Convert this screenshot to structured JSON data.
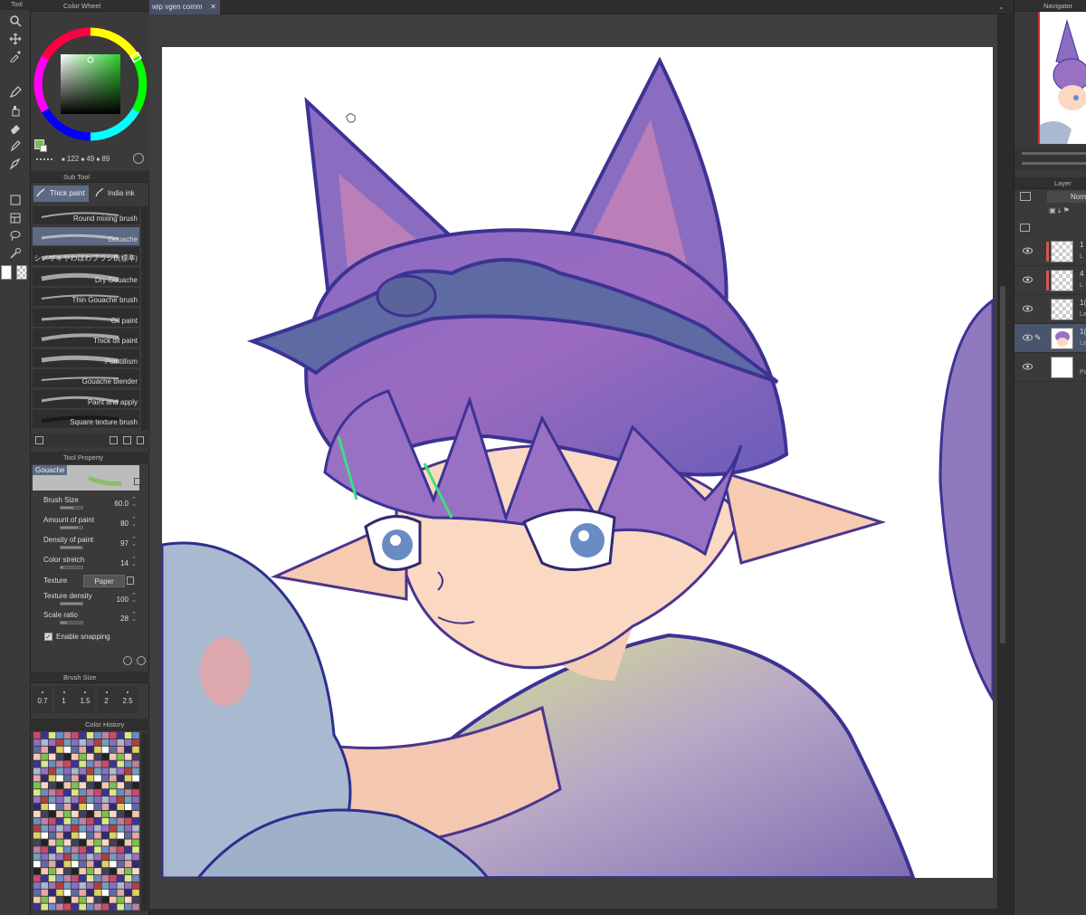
{
  "colors": {
    "accent": "#5d6a85",
    "panel": "#3a3a3a",
    "canvas": "#ffffff",
    "selected_layer": "#49546d",
    "main_color": "#7ac14f"
  },
  "tools_panel": {
    "title": "Tool"
  },
  "color_wheel": {
    "title": "Color Wheel",
    "h": "122",
    "s": "49",
    "v": "89"
  },
  "sub_tool": {
    "title": "Sub Tool",
    "groups": [
      "Thick paint",
      "India ink"
    ],
    "brushes": [
      {
        "label": "Round mixing brush"
      },
      {
        "label": "Gouache"
      },
      {
        "label": "シノザキやわほわブラシB(標準)"
      },
      {
        "label": "Dry Gouache"
      },
      {
        "label": "Thin Gouache brush"
      },
      {
        "label": "Oil paint"
      },
      {
        "label": "Thick oil paint"
      },
      {
        "label": "Pointillism"
      },
      {
        "label": "Gouache blender"
      },
      {
        "label": "Paint and apply"
      },
      {
        "label": "Square texture brush"
      }
    ]
  },
  "tool_property": {
    "title": "Tool Property",
    "brush_name": "Gouache",
    "rows": [
      {
        "label": "Brush Size",
        "value": "60.0",
        "level": 0.6
      },
      {
        "label": "Amount of paint",
        "value": "80",
        "level": 0.8
      },
      {
        "label": "Density of paint",
        "value": "97",
        "level": 0.97
      },
      {
        "label": "Color stretch",
        "value": "14",
        "level": 0.14
      }
    ],
    "texture_label": "Texture",
    "texture_value": "Paper",
    "rows2": [
      {
        "label": "Texture density",
        "value": "100",
        "level": 1.0
      },
      {
        "label": "Scale ratio",
        "value": "28",
        "level": 0.28
      }
    ],
    "snapping_label": "Enable snapping"
  },
  "brush_size_panel": {
    "title": "Brush Size",
    "sizes": [
      "0.7",
      "1",
      "1.5",
      "2",
      "2.5"
    ]
  },
  "color_history": {
    "title": "Color History"
  },
  "document_tab": {
    "title": "wip vgen comm"
  },
  "navigator": {
    "title": "Navigator"
  },
  "layer_panel": {
    "title": "Layer",
    "blend_mode": "Normal",
    "layers": [
      {
        "n1": "1",
        "n2": "L"
      },
      {
        "n1": "4",
        "n2": "L"
      },
      {
        "n1": "1(",
        "n2": "La"
      },
      {
        "n1": "1(",
        "n2": "La"
      },
      {
        "n1": "",
        "n2": "Pa"
      }
    ]
  }
}
